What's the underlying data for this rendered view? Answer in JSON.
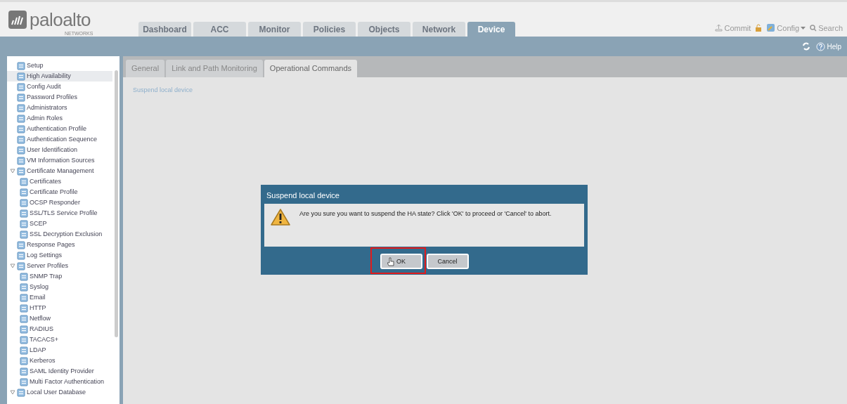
{
  "header": {
    "logo_text": "paloalto",
    "logo_subtext": "NETWORKS",
    "tabs": [
      {
        "label": "Dashboard",
        "selected": false
      },
      {
        "label": "ACC",
        "selected": false
      },
      {
        "label": "Monitor",
        "selected": false
      },
      {
        "label": "Policies",
        "selected": false
      },
      {
        "label": "Objects",
        "selected": false
      },
      {
        "label": "Network",
        "selected": false
      },
      {
        "label": "Device",
        "selected": true
      }
    ],
    "actions": [
      {
        "label": "Commit",
        "kind": "commit"
      },
      {
        "kind": "lock"
      },
      {
        "label": "Config",
        "kind": "config"
      },
      {
        "label": "Search",
        "kind": "search"
      }
    ],
    "help": "Help"
  },
  "sidebar": {
    "items": [
      {
        "label": "Setup",
        "selected": false
      },
      {
        "label": "High Availability",
        "selected": true
      },
      {
        "label": "Config Audit",
        "selected": false
      },
      {
        "label": "Password Profiles",
        "selected": false
      },
      {
        "label": "Administrators",
        "selected": false
      },
      {
        "label": "Admin Roles",
        "selected": false
      },
      {
        "label": "Authentication Profile",
        "selected": false
      },
      {
        "label": "Authentication Sequence",
        "selected": false
      },
      {
        "label": "User Identification",
        "selected": false
      },
      {
        "label": "VM Information Sources",
        "selected": false
      },
      {
        "label": "Certificate Management",
        "selected": false,
        "expanded": true,
        "children": [
          {
            "label": "Certificates",
            "selected": false
          },
          {
            "label": "Certificate Profile",
            "selected": false
          },
          {
            "label": "OCSP Responder",
            "selected": false
          },
          {
            "label": "SSL/TLS Service Profile",
            "selected": false
          },
          {
            "label": "SCEP",
            "selected": false
          },
          {
            "label": "SSL Decryption Exclusion",
            "selected": false
          }
        ]
      },
      {
        "label": "Response Pages",
        "selected": false
      },
      {
        "label": "Log Settings",
        "selected": false
      },
      {
        "label": "Server Profiles",
        "selected": false,
        "expanded": true,
        "children": [
          {
            "label": "SNMP Trap",
            "selected": false
          },
          {
            "label": "Syslog",
            "selected": false
          },
          {
            "label": "Email",
            "selected": false
          },
          {
            "label": "HTTP",
            "selected": false
          },
          {
            "label": "Netflow",
            "selected": false
          },
          {
            "label": "RADIUS",
            "selected": false
          },
          {
            "label": "TACACS+",
            "selected": false
          },
          {
            "label": "LDAP",
            "selected": false
          },
          {
            "label": "Kerberos",
            "selected": false
          },
          {
            "label": "SAML Identity Provider",
            "selected": false
          },
          {
            "label": "Multi Factor Authentication",
            "selected": false
          }
        ]
      },
      {
        "label": "Local User Database",
        "selected": false,
        "expanded": true
      }
    ]
  },
  "content": {
    "tabs": [
      {
        "label": "General",
        "selected": false
      },
      {
        "label": "Link and Path Monitoring",
        "selected": false
      },
      {
        "label": "Operational Commands",
        "selected": true
      }
    ],
    "link": "Suspend local device"
  },
  "dialog": {
    "title": "Suspend local device",
    "message": "Are you sure you want to suspend the HA state? Click 'OK' to proceed or 'Cancel' to abort.",
    "buttons": [
      {
        "label": "OK",
        "highlighted": true
      },
      {
        "label": "Cancel",
        "highlighted": false
      }
    ]
  }
}
